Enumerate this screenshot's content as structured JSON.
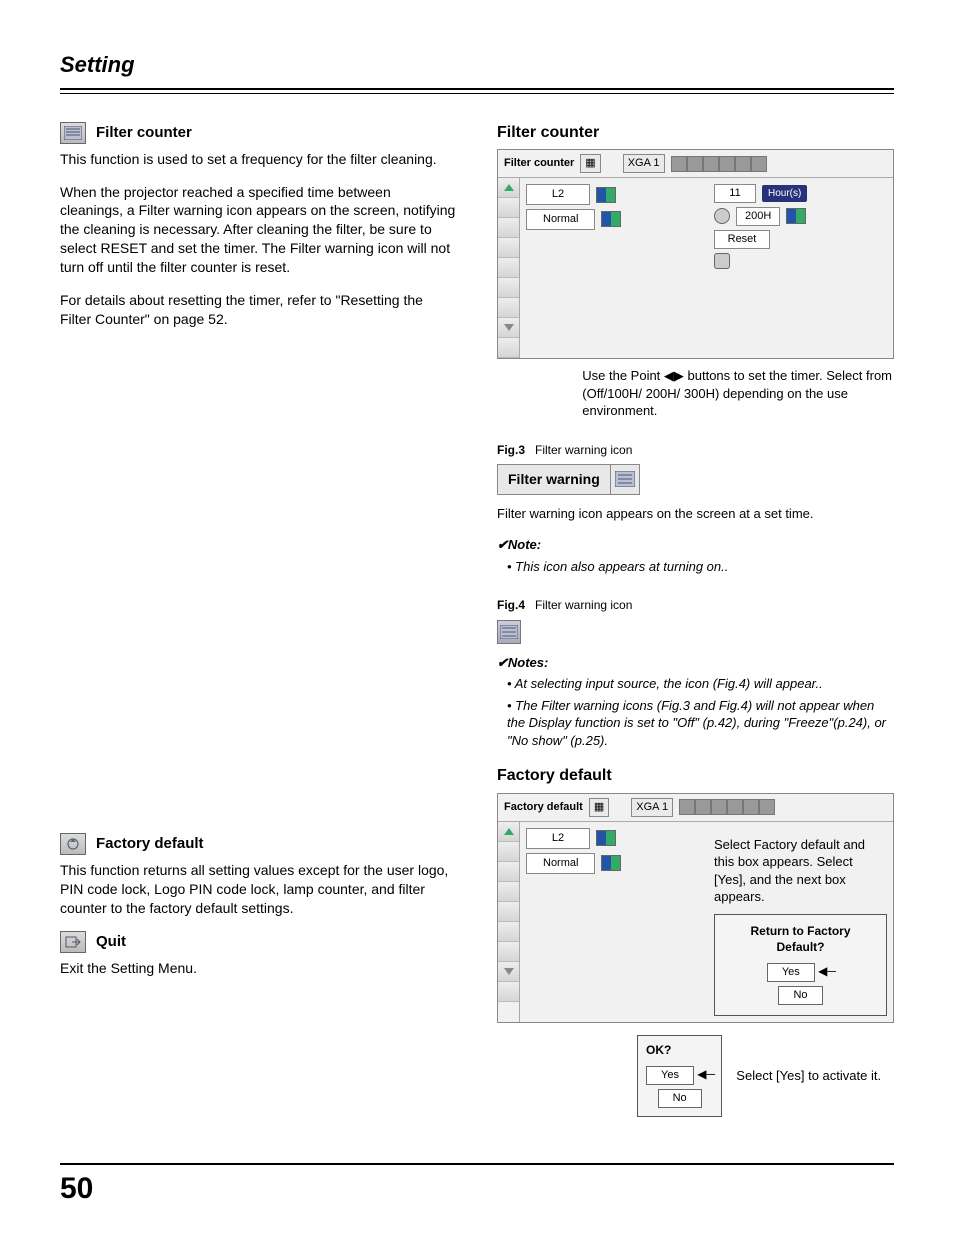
{
  "header": {
    "title": "Setting"
  },
  "left": {
    "filter_counter": {
      "title": "Filter counter",
      "p1": "This function is used to set a frequency for the filter cleaning.",
      "p2": "When the projector reached a specified time between cleanings, a Filter warning icon appears on the screen, notifying the cleaning is necessary. After cleaning the filter, be sure to select RESET and set the timer. The Filter warning icon will not turn off until the filter counter is reset.",
      "p3": "For details about resetting the timer, refer to \"Resetting the Filter Counter\" on page 52."
    },
    "factory_default": {
      "title": "Factory default",
      "p1": "This function returns all setting values except for the user logo, PIN code lock, Logo PIN code lock, lamp counter, and filter counter to the factory default settings."
    },
    "quit": {
      "title": "Quit",
      "p1": "Exit the Setting Menu."
    }
  },
  "right": {
    "filter_counter": {
      "title": "Filter counter",
      "osd": {
        "label": "Filter counter",
        "resolution": "XGA 1",
        "row1": "L2",
        "row2": "Normal",
        "val1": "11",
        "val2": "200H",
        "val3": "Reset",
        "hours": "Hour(s)"
      },
      "usenote": "Use the Point ◀▶ buttons to set the timer. Select from (Off/100H/ 200H/ 300H) depending on the use environment."
    },
    "fig3": {
      "label": "Fig.3",
      "caption": "Filter warning icon",
      "pill": "Filter warning",
      "desc": "Filter warning icon appears on the screen at a set time.",
      "noteTitle": "✔Note:",
      "note1": "This icon also appears at turning on.."
    },
    "fig4": {
      "label": "Fig.4",
      "caption": "Filter warning icon",
      "noteTitle": "✔Notes:",
      "note1": "At selecting input source, the icon (Fig.4) will appear..",
      "note2": "The Filter warning icons (Fig.3 and Fig.4) will not appear when the Display function is set to \"Off\" (p.42), during \"Freeze\"(p.24), or \"No show\" (p.25)."
    },
    "factory_default": {
      "title": "Factory default",
      "osd": {
        "label": "Factory default",
        "resolution": "XGA 1",
        "row1": "L2",
        "row2": "Normal"
      },
      "desc": "Select Factory default and this box appears. Select [Yes], and the next box appears.",
      "dialog1": {
        "q": "Return to Factory Default?",
        "yes": "Yes",
        "no": "No"
      },
      "dialog2": {
        "q": "OK?",
        "yes": "Yes",
        "no": "No"
      },
      "activate": "Select [Yes] to activate it."
    }
  },
  "pageNumber": "50"
}
